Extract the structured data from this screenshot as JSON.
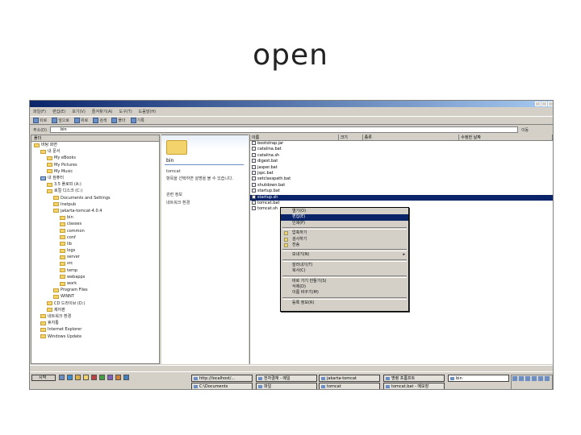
{
  "slide_title": "open",
  "window": {
    "menu": [
      "파일(F)",
      "편집(E)",
      "보기(V)",
      "즐겨찾기(A)",
      "도구(T)",
      "도움말(H)"
    ],
    "toolbar": [
      "뒤로",
      "앞으로",
      "위로",
      "검색",
      "폴더",
      "기록"
    ],
    "address_label": "주소(D)",
    "address_value": "bin",
    "go_label": "이동"
  },
  "folder_pane": {
    "header": "폴더",
    "items": [
      "바탕 화면",
      "내 문서",
      "My eBooks",
      "My Pictures",
      "My Music",
      "내 컴퓨터",
      "3.5 플로피 (A:)",
      "로컬 디스크 (C:)",
      "Documents and Settings",
      "Inetpub",
      "jakarta-tomcat-4.0.4",
      "bin",
      "classes",
      "common",
      "conf",
      "lib",
      "logs",
      "server",
      "src",
      "temp",
      "webapps",
      "work",
      "Program Files",
      "WINNT",
      "CD 드라이브 (D:)",
      "제어판",
      "네트워크 환경",
      "휴지통",
      "Internet Explorer",
      "Windows Update"
    ]
  },
  "web_view": {
    "folder_name": "bin",
    "description": "tomcat",
    "detail": "항목을 선택하면 설명을 볼 수 있습니다.",
    "links": [
      "관련 정보",
      "네트워크 환경"
    ]
  },
  "file_list": {
    "columns": [
      "이름",
      "크기",
      "종류",
      "수정한 날짜"
    ],
    "rows": [
      {
        "name": "bootstrap.jar",
        "size": "",
        "type": "",
        "date": ""
      },
      {
        "name": "catalina.bat",
        "size": "",
        "type": "",
        "date": ""
      },
      {
        "name": "catalina.sh",
        "size": "",
        "type": "",
        "date": ""
      },
      {
        "name": "digest.bat",
        "size": "",
        "type": "",
        "date": ""
      },
      {
        "name": "jasper.bat",
        "size": "",
        "type": "",
        "date": ""
      },
      {
        "name": "jspc.bat",
        "size": "",
        "type": "",
        "date": ""
      },
      {
        "name": "setclasspath.bat",
        "size": "",
        "type": "",
        "date": ""
      },
      {
        "name": "shutdown.bat",
        "size": "",
        "type": "",
        "date": ""
      },
      {
        "name": "startup.bat",
        "size": "",
        "type": "",
        "date": ""
      },
      {
        "name": "startup.sh",
        "size": "",
        "type": "",
        "date": ""
      },
      {
        "name": "tomcat.bat",
        "size": "",
        "type": "",
        "date": ""
      },
      {
        "name": "tomcat.sh",
        "size": "",
        "type": "",
        "date": ""
      }
    ]
  },
  "context_menu": {
    "items": [
      {
        "label": "열기(O)",
        "highlight": false
      },
      {
        "label": "편집(E)",
        "highlight": true
      },
      {
        "label": "인쇄(P)",
        "highlight": false
      },
      {
        "label": "압축하기",
        "highlight": false
      },
      {
        "label": "검사하기",
        "highlight": false
      },
      {
        "label": "전송",
        "highlight": false
      },
      {
        "label": "보내기(N)",
        "highlight": false,
        "submenu": true
      },
      {
        "label": "잘라내기(T)",
        "highlight": false
      },
      {
        "label": "복사(C)",
        "highlight": false
      },
      {
        "label": "바로 가기 만들기(S)",
        "highlight": false
      },
      {
        "label": "삭제(D)",
        "highlight": false
      },
      {
        "label": "이름 바꾸기(M)",
        "highlight": false
      },
      {
        "label": "등록 정보(R)",
        "highlight": false
      }
    ],
    "submenu_arrow": "▸"
  },
  "status_bar": "",
  "taskbar": {
    "start_label": "시작",
    "buttons": [
      "http://localhost/...",
      "전자결재 - 메일",
      "jakarta-tomcat",
      "명령 프롬프트",
      "bin",
      "C:\\Documents",
      "파일",
      "tomcat",
      "tomcat.bat - 메모장"
    ]
  }
}
